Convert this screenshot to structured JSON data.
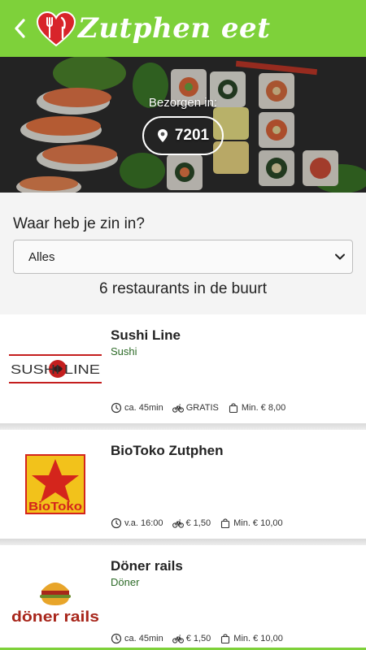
{
  "header": {
    "brand": "Zutphen eet"
  },
  "hero": {
    "delivery_label": "Bezorgen in:",
    "postcode": "7201"
  },
  "filter": {
    "question": "Waar heb je zin in?",
    "selected": "Alles",
    "count_text": "6 restaurants in de buurt"
  },
  "logos": {
    "sushi_line": "SUSHI LINE",
    "biotoko": "BioToko",
    "doner_rails": "döner rails"
  },
  "restaurants": [
    {
      "name": "Sushi Line",
      "category": "Sushi",
      "time": "ca. 45min",
      "delivery": "GRATIS",
      "minimum": "Min. € 8,00"
    },
    {
      "name": "BioToko Zutphen",
      "category": "",
      "time": "v.a. 16:00",
      "delivery": "€ 1,50",
      "minimum": "Min. € 10,00"
    },
    {
      "name": "Döner rails",
      "category": "Döner",
      "time": "ca. 45min",
      "delivery": "€ 1,50",
      "minimum": "Min. € 10,00"
    }
  ],
  "colors": {
    "brand_green": "#7ed13a",
    "category_green": "#2d6b28",
    "biotoko_yellow": "#f2c21b",
    "biotoko_red": "#d4251c",
    "doner_orange": "#e8a52a",
    "doner_red": "#a8261b"
  }
}
